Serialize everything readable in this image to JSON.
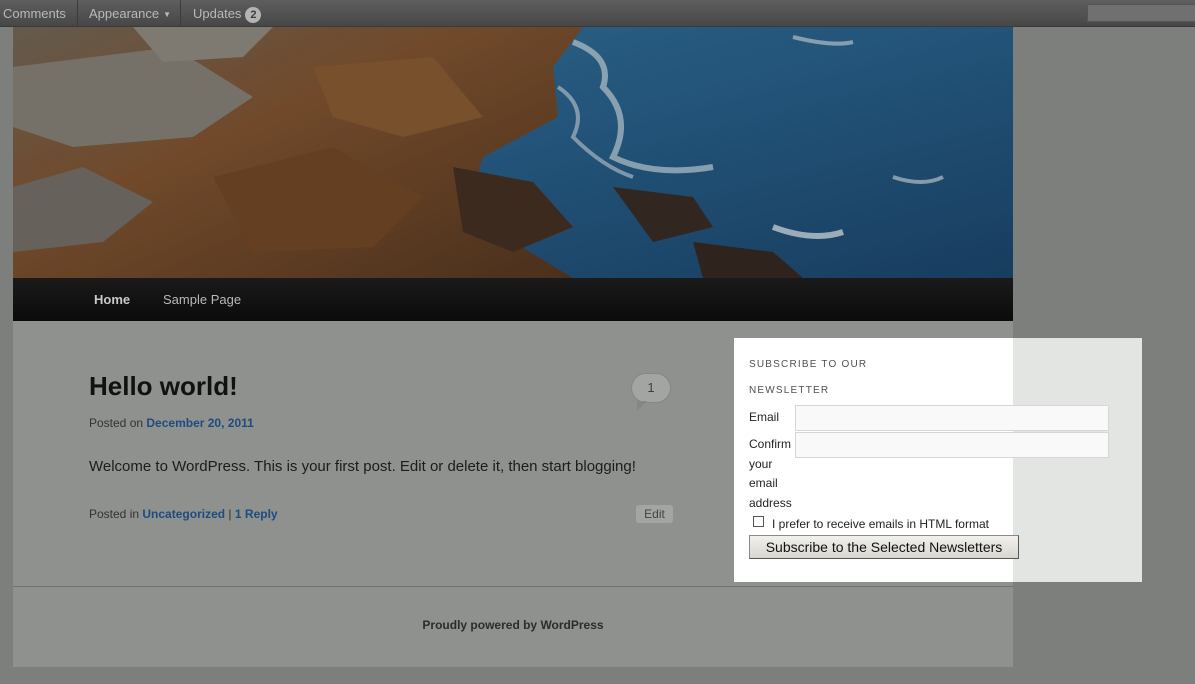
{
  "admin_bar": {
    "items": [
      {
        "label": "Comments"
      },
      {
        "label": "Appearance"
      },
      {
        "label": "Updates",
        "count": "2"
      }
    ]
  },
  "nav": {
    "items": [
      {
        "label": "Home",
        "current": true
      },
      {
        "label": "Sample Page"
      }
    ]
  },
  "post": {
    "title": "Hello world!",
    "comment_count": "1",
    "posted_on_label": "Posted on",
    "date": "December 20, 2011",
    "content": "Welcome to WordPress. This is your first post. Edit or delete it, then start blogging!",
    "posted_in_label": "Posted in",
    "category": "Uncategorized",
    "separator": "|",
    "reply_link": "1 Reply",
    "edit_label": "Edit"
  },
  "footer": {
    "credit": "Proudly powered by WordPress"
  },
  "newsletter_widget": {
    "title_line1": "SUBSCRIBE TO OUR",
    "title_line2": "NEWSLETTER",
    "email_label": "Email",
    "email_value": "",
    "confirm_label_lines": [
      "Confirm",
      "your",
      "email",
      "address"
    ],
    "confirm_value": "",
    "html_format_label": "I prefer to receive emails in HTML format",
    "html_format_checked": false,
    "subscribe_button": "Subscribe to the Selected Newsletters"
  },
  "colors": {
    "overlay_dim": "#7c7f7b",
    "link_blue": "#1e4b80",
    "widget_background": "#ffffff",
    "nav_background": "#111111"
  }
}
